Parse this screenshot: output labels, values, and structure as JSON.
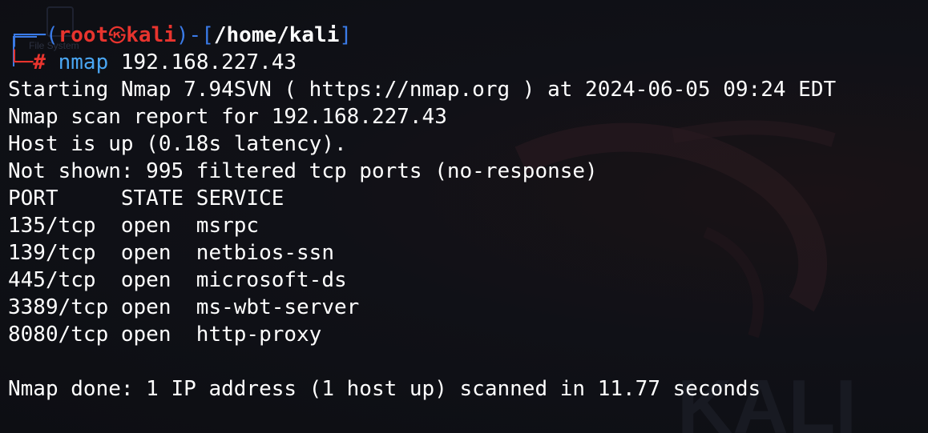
{
  "prompt": {
    "open": "┌──(",
    "user": "root",
    "skull": "㉿",
    "host": "kali",
    "mid": ")-[",
    "cwd": "/home/kali",
    "close": "]",
    "hash": "└─#",
    "command": "nmap",
    "args": " 192.168.227.43"
  },
  "output": [
    "Starting Nmap 7.94SVN ( https://nmap.org ) at 2024-06-05 09:24 EDT",
    "Nmap scan report for 192.168.227.43",
    "Host is up (0.18s latency).",
    "Not shown: 995 filtered tcp ports (no-response)",
    "PORT     STATE SERVICE",
    "135/tcp  open  msrpc",
    "139/tcp  open  netbios-ssn",
    "445/tcp  open  microsoft-ds",
    "3389/tcp open  ms-wbt-server",
    "8080/tcp open  http-proxy",
    "",
    "Nmap done: 1 IP address (1 host up) scanned in 11.77 seconds"
  ],
  "desktop": {
    "ghost_label": "File System"
  },
  "watermark": {
    "text": "KALI"
  },
  "colors": {
    "background": "#0e0f14",
    "prompt_bracket": "#3a7be8",
    "prompt_user": "#e8342e",
    "command": "#4aa6f2",
    "text": "#ffffff"
  }
}
